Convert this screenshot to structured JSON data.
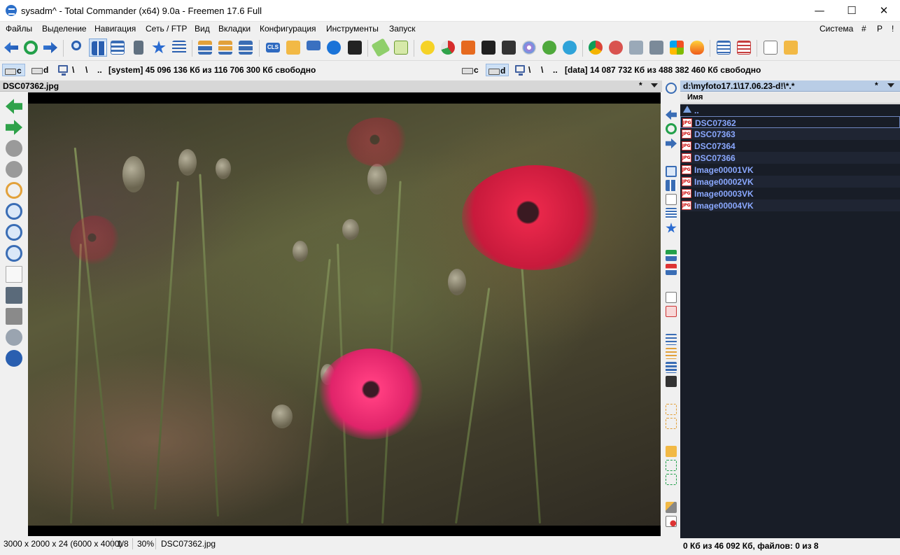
{
  "window": {
    "title": "sysadm^ - Total Commander (x64) 9.0a - Freemen 17.6 Full",
    "minimize": "—",
    "maximize": "☐",
    "close": "✕"
  },
  "menu": {
    "items": [
      "Файлы",
      "Выделение",
      "Навигация",
      "Сеть / FTP",
      "Вид",
      "Вкладки",
      "Конфигурация",
      "Инструменты",
      "Запуск"
    ],
    "right": [
      "Система",
      "#",
      "P",
      "!"
    ]
  },
  "toolbar": {
    "icons": [
      "back-icon",
      "refresh-icon",
      "forward-icon",
      "search-files-icon",
      "thumbnails-view-icon",
      "brief-view-icon",
      "calculator-icon",
      "favorites-icon",
      "list-view-icon",
      "tree-left-icon",
      "tree-both-icon",
      "tree-right-icon",
      "cls-icon",
      "folder-icon",
      "network-icon",
      "teamviewer-icon",
      "terminal-icon",
      "notepad-icon",
      "editor-icon",
      "pdf-icon",
      "chart-icon",
      "photo-editor-icon",
      "xmplay-icon",
      "mpc-icon",
      "dvd-icon",
      "utorrent-icon",
      "telegram-icon",
      "chrome-icon",
      "cleaner-icon",
      "archive-icon",
      "system-tools-icon",
      "windows-icon",
      "fire-icon",
      "panel-view-icon",
      "grid-view-icon",
      "new-file-icon",
      "new-folder-icon"
    ],
    "cls_label": "CLS"
  },
  "left_drives": {
    "c": "c",
    "d": "d",
    "root": "\\",
    "up": "..",
    "info": "[system]  45 096 136 Кб из 116 706 300 Кб свободно"
  },
  "right_drives": {
    "c": "c",
    "d": "d",
    "root": "\\",
    "up": "..",
    "info": "[data]  14 087 732 Кб из 488 382 460 Кб свободно"
  },
  "left_panel": {
    "filename": "DSC07362.jpg",
    "star": "*"
  },
  "right_panel": {
    "path": "d:\\myfoto17.1\\17.06.23-d!\\*.*",
    "star": "*",
    "column_name": "Имя",
    "updir": "..",
    "files": [
      "DSC07362",
      "DSC07363",
      "DSC07364",
      "DSC07366",
      "Image00001VK",
      "Image00002VK",
      "Image00003VK",
      "Image00004VK"
    ]
  },
  "status_left": {
    "dimensions": "3000 x 2000 x 24 (6000 x 4000)",
    "index": "1/8",
    "zoom": "30%",
    "filename": "DSC07362.jpg"
  },
  "status_right": {
    "summary": "0 Кб из 46 092 Кб, файлов: 0 из 8"
  },
  "colors": {
    "panel_bg": "#181d27",
    "file_text": "#8aa8ff",
    "header_active": "#b9cde6"
  }
}
